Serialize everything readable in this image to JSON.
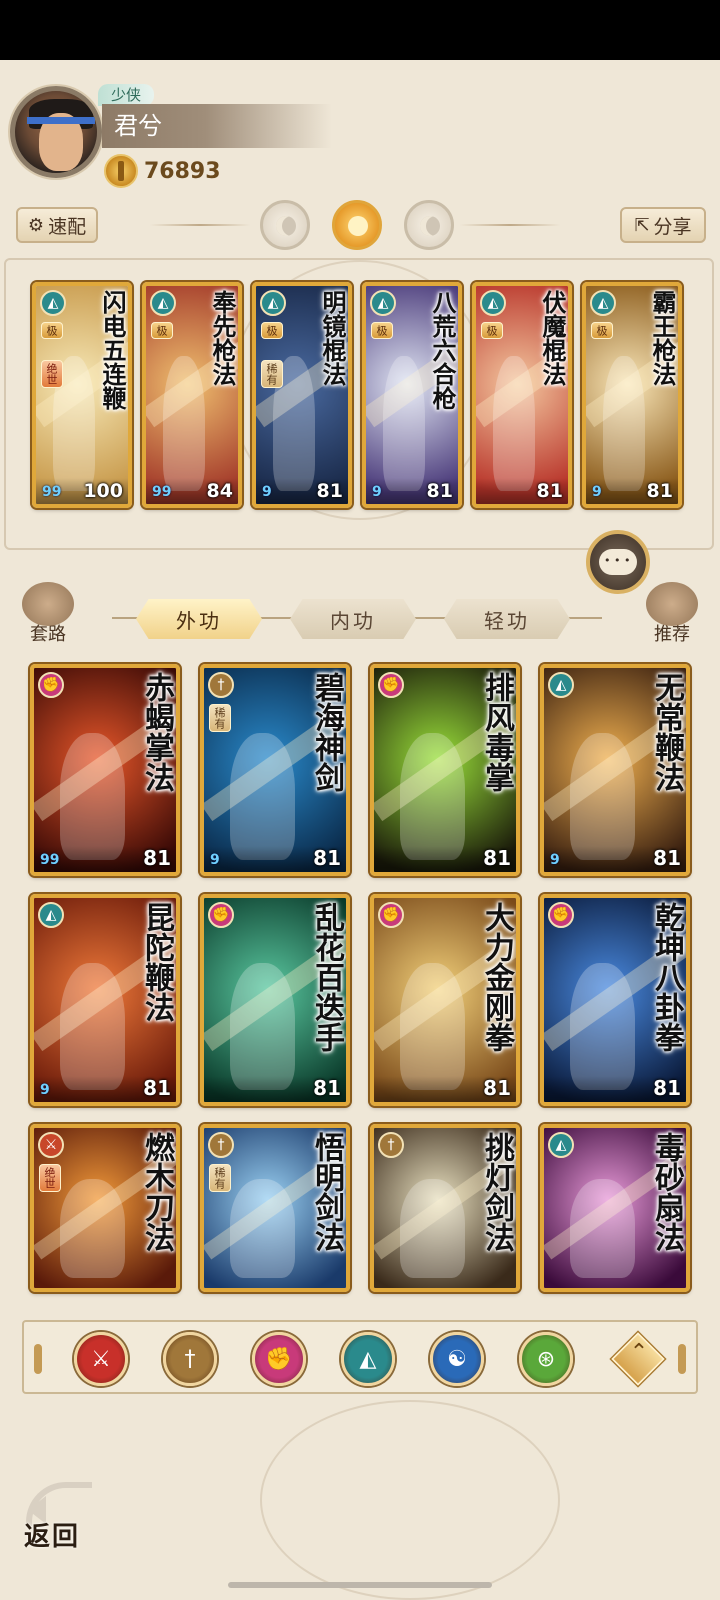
{
  "player": {
    "rank": "少侠",
    "name": "君兮",
    "coins": "76893"
  },
  "top_actions": {
    "quick_label": "速配",
    "share_label": "分享"
  },
  "equipped": [
    {
      "title": "闪电五连鞭",
      "tag": "绝世",
      "grade": "极",
      "level": "100",
      "school_icon": "fan-school-icon",
      "school_color": "#2a8a8c",
      "bg": [
        "#f7e9b8",
        "#c89a4c"
      ],
      "marks": "99"
    },
    {
      "title": "奉先枪法",
      "tag": "",
      "grade": "极",
      "level": "84",
      "school_icon": "fan-school-icon",
      "school_color": "#2a8a8c",
      "bg": [
        "#f0c070",
        "#a33a2a"
      ],
      "marks": "99"
    },
    {
      "title": "明镜棍法",
      "tag": "稀有",
      "grade": "极",
      "level": "81",
      "school_icon": "fan-school-icon",
      "school_color": "#2a8a8c",
      "bg": [
        "#4a6aa0",
        "#1a2a4a"
      ],
      "marks": "9"
    },
    {
      "title": "八荒六合枪",
      "tag": "",
      "grade": "极",
      "level": "81",
      "school_icon": "fan-school-icon",
      "school_color": "#2a8a8c",
      "bg": [
        "#dfe4f2",
        "#4a3a7a"
      ],
      "marks": "9"
    },
    {
      "title": "伏魔棍法",
      "tag": "",
      "grade": "极",
      "level": "81",
      "school_icon": "fan-school-icon",
      "school_color": "#2a8a8c",
      "bg": [
        "#f4c8a0",
        "#b8342a"
      ],
      "marks": ""
    },
    {
      "title": "霸王枪法",
      "tag": "",
      "grade": "极",
      "level": "81",
      "school_icon": "fan-school-icon",
      "school_color": "#2a8a8c",
      "bg": [
        "#f9e6b8",
        "#8a5a1a"
      ],
      "marks": "9"
    }
  ],
  "categories": {
    "left_label": "套路",
    "right_label": "推荐",
    "tabs": [
      "外功",
      "内功",
      "轻功"
    ],
    "active_tab": 0
  },
  "skills": [
    {
      "title": "赤蝎掌法",
      "tag": "",
      "level": "81",
      "school_icon": "fist-school-icon",
      "school_color": "#c83a7a",
      "bg": [
        "#e8572a",
        "#3a0a06"
      ],
      "marks": "99"
    },
    {
      "title": "碧海神剑",
      "tag": "稀有",
      "level": "81",
      "school_icon": "sword-school-icon",
      "school_color": "#a0773a",
      "bg": [
        "#2a8acb",
        "#0a2a4a"
      ],
      "marks": "9"
    },
    {
      "title": "排风毒掌",
      "tag": "",
      "level": "81",
      "school_icon": "fist-school-icon",
      "school_color": "#c83a7a",
      "bg": [
        "#9ae03a",
        "#1a1a0a"
      ],
      "marks": ""
    },
    {
      "title": "无常鞭法",
      "tag": "",
      "level": "81",
      "school_icon": "fan-school-icon",
      "school_color": "#2a8a8c",
      "bg": [
        "#f0b050",
        "#3a2010"
      ],
      "marks": "9"
    },
    {
      "title": "昆陀鞭法",
      "tag": "",
      "level": "81",
      "school_icon": "fan-school-icon",
      "school_color": "#2a8a8c",
      "bg": [
        "#f07a3a",
        "#6a1a0a"
      ],
      "marks": "9"
    },
    {
      "title": "乱花百迭手",
      "tag": "",
      "level": "81",
      "school_icon": "fist-school-icon",
      "school_color": "#c83a7a",
      "bg": [
        "#5ac8a0",
        "#0a3a2a"
      ],
      "marks": ""
    },
    {
      "title": "大力金刚拳",
      "tag": "",
      "level": "81",
      "school_icon": "fist-school-icon",
      "school_color": "#c83a7a",
      "bg": [
        "#f2d07a",
        "#7a4a1a"
      ],
      "marks": ""
    },
    {
      "title": "乾坤八卦拳",
      "tag": "",
      "level": "81",
      "school_icon": "fist-school-icon",
      "school_color": "#c83a7a",
      "bg": [
        "#4a8ae0",
        "#0a1a3a"
      ],
      "marks": ""
    },
    {
      "title": "燃木刀法",
      "tag": "绝世",
      "level": "",
      "school_icon": "blade-school-icon",
      "school_color": "#c8472a",
      "bg": [
        "#f29a3a",
        "#5a1a0a"
      ],
      "marks": ""
    },
    {
      "title": "悟明剑法",
      "tag": "稀有",
      "level": "",
      "school_icon": "sword-school-icon",
      "school_color": "#a0773a",
      "bg": [
        "#9ad0f2",
        "#1a3a6a"
      ],
      "marks": ""
    },
    {
      "title": "挑灯剑法",
      "tag": "",
      "level": "",
      "school_icon": "sword-school-icon",
      "school_color": "#a0773a",
      "bg": [
        "#e8e0c0",
        "#3a2a1a"
      ],
      "marks": ""
    },
    {
      "title": "毒砂扇法",
      "tag": "",
      "level": "",
      "school_icon": "fan-school-icon",
      "school_color": "#2a8a8c",
      "bg": [
        "#e89ad8",
        "#3a0a3a"
      ],
      "marks": ""
    }
  ],
  "filters": [
    {
      "name": "blade-filter-icon",
      "glyph": "⚔",
      "color": "#c8302a"
    },
    {
      "name": "sword-filter-icon",
      "glyph": "†",
      "color": "#a0773a"
    },
    {
      "name": "fist-filter-icon",
      "glyph": "✊",
      "color": "#c83a7a"
    },
    {
      "name": "fan-filter-icon",
      "glyph": "◭",
      "color": "#2a8a8c"
    },
    {
      "name": "yinyang-filter-icon",
      "glyph": "☯",
      "color": "#2a6ab8"
    },
    {
      "name": "whip-filter-icon",
      "glyph": "⊛",
      "color": "#5aa83a"
    }
  ],
  "back_label": "返回"
}
